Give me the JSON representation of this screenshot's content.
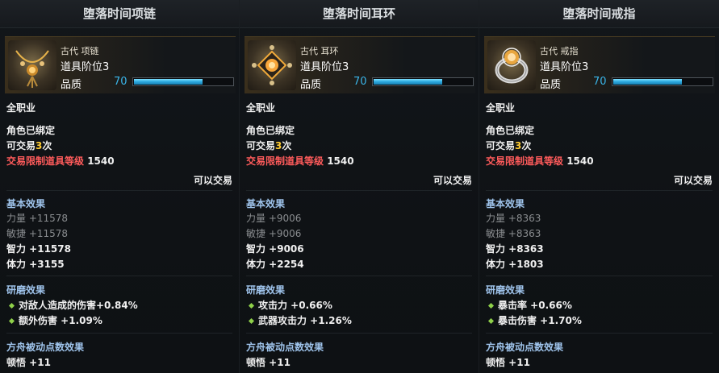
{
  "items": [
    {
      "name": "堕落时间项链",
      "grade": "古代 项链",
      "tier": "道具阶位3",
      "quality_label": "品质",
      "quality": 70,
      "class": "全职业",
      "bound": "角色已绑定",
      "trade_count_prefix": "可交易",
      "trade_count": "3",
      "trade_count_suffix": "次",
      "trade_limit_label": "交易限制道具等级",
      "trade_limit_value": "1540",
      "tradable": "可以交易",
      "basic_header": "基本效果",
      "basic": [
        {
          "text": "力量 +11578",
          "dim": true
        },
        {
          "text": "敏捷 +11578",
          "dim": true
        },
        {
          "text": "智力 +11578",
          "dim": false
        },
        {
          "text": "体力 +3155",
          "dim": false
        }
      ],
      "refine_header": "研磨效果",
      "refine": [
        "对敌人造成的伤害+0.84%",
        "额外伤害 +1.09%"
      ],
      "ark_header": "方舟被动点数效果",
      "ark": "顿悟 +11",
      "icon_color": "#e6b24a"
    },
    {
      "name": "堕落时间耳环",
      "grade": "古代 耳环",
      "tier": "道具阶位3",
      "quality_label": "品质",
      "quality": 70,
      "class": "全职业",
      "bound": "角色已绑定",
      "trade_count_prefix": "可交易",
      "trade_count": "3",
      "trade_count_suffix": "次",
      "trade_limit_label": "交易限制道具等级",
      "trade_limit_value": "1540",
      "tradable": "可以交易",
      "basic_header": "基本效果",
      "basic": [
        {
          "text": "力量 +9006",
          "dim": true
        },
        {
          "text": "敏捷 +9006",
          "dim": true
        },
        {
          "text": "智力 +9006",
          "dim": false
        },
        {
          "text": "体力 +2254",
          "dim": false
        }
      ],
      "refine_header": "研磨效果",
      "refine": [
        "攻击力 +0.66%",
        "武器攻击力 +1.26%"
      ],
      "ark_header": "方舟被动点数效果",
      "ark": "顿悟 +11",
      "icon_color": "#f0a93a"
    },
    {
      "name": "堕落时间戒指",
      "grade": "古代 戒指",
      "tier": "道具阶位3",
      "quality_label": "品质",
      "quality": 70,
      "class": "全职业",
      "bound": "角色已绑定",
      "trade_count_prefix": "可交易",
      "trade_count": "3",
      "trade_count_suffix": "次",
      "trade_limit_label": "交易限制道具等级",
      "trade_limit_value": "1540",
      "tradable": "可以交易",
      "basic_header": "基本效果",
      "basic": [
        {
          "text": "力量 +8363",
          "dim": true
        },
        {
          "text": "敏捷 +8363",
          "dim": true
        },
        {
          "text": "智力 +8363",
          "dim": false
        },
        {
          "text": "体力 +1803",
          "dim": false
        }
      ],
      "refine_header": "研磨效果",
      "refine": [
        "暴击率 +0.66%",
        "暴击伤害 +1.70%"
      ],
      "ark_header": "方舟被动点数效果",
      "ark": "顿悟 +11",
      "icon_color": "#d9d9d9"
    }
  ],
  "colors": {
    "quality_value": "#3ab6ea",
    "trade_count": "#ffcc33",
    "trade_limit": "#ff5b5b",
    "section_header": "#9fc4ec",
    "bullet": "#8fd14a"
  },
  "icons": {
    "item_0": "necklace-icon",
    "item_1": "earring-icon",
    "item_2": "ring-icon",
    "bullet": "diamond-bullet-icon"
  }
}
